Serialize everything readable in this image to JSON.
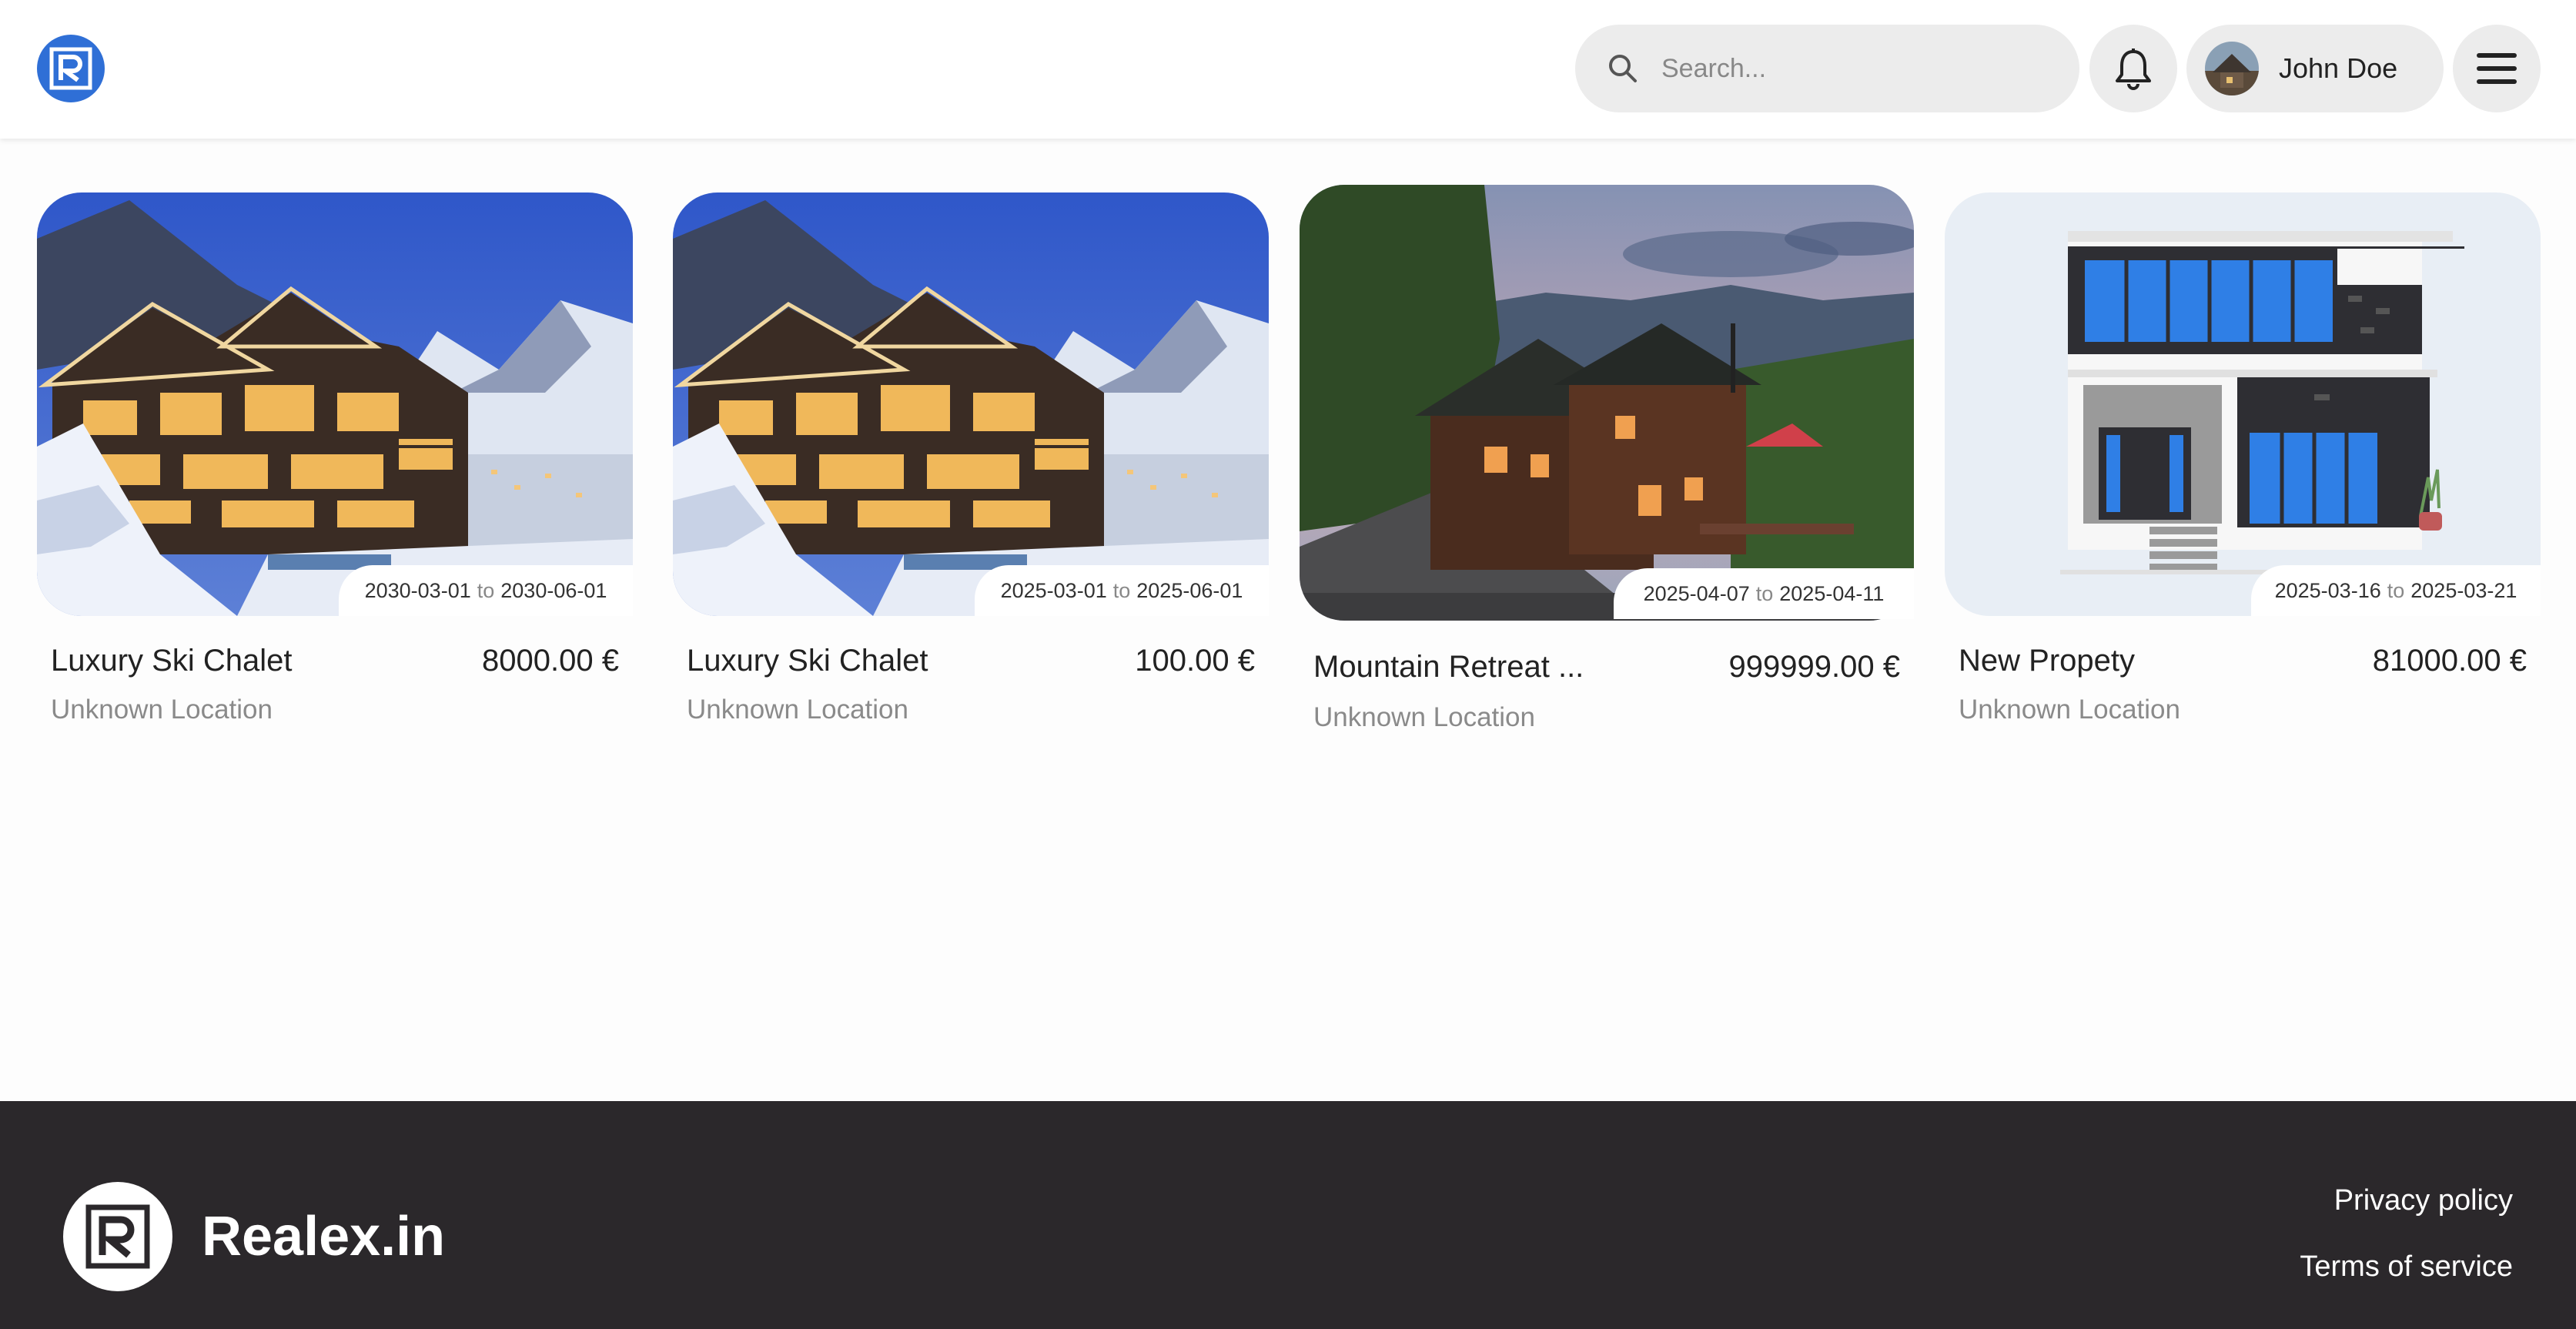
{
  "header": {
    "search_placeholder": "Search...",
    "user_name": "John Doe"
  },
  "listings": [
    {
      "title": "Luxury Ski Chalet",
      "price": "8000.00 €",
      "location": "Unknown Location",
      "date_from": "2030-03-01",
      "date_sep": "to",
      "date_to": "2030-06-01"
    },
    {
      "title": "Luxury Ski Chalet",
      "price": "100.00 €",
      "location": "Unknown Location",
      "date_from": "2025-03-01",
      "date_sep": "to",
      "date_to": "2025-06-01"
    },
    {
      "title": "Mountain Retreat ...",
      "price": "999999.00 €",
      "location": "Unknown Location",
      "date_from": "2025-04-07",
      "date_sep": "to",
      "date_to": "2025-04-11"
    },
    {
      "title": "New Propety",
      "price": "81000.00 €",
      "location": "Unknown Location",
      "date_from": "2025-03-16",
      "date_sep": "to",
      "date_to": "2025-03-21"
    }
  ],
  "footer": {
    "brand": "Realex.in",
    "links": [
      "Privacy policy",
      "Terms of service"
    ]
  },
  "colors": {
    "brand_blue": "#2f6fd6",
    "footer_bg": "#2b282b"
  },
  "icons": [
    "logo-icon",
    "search-icon",
    "bell-icon",
    "menu-icon"
  ]
}
